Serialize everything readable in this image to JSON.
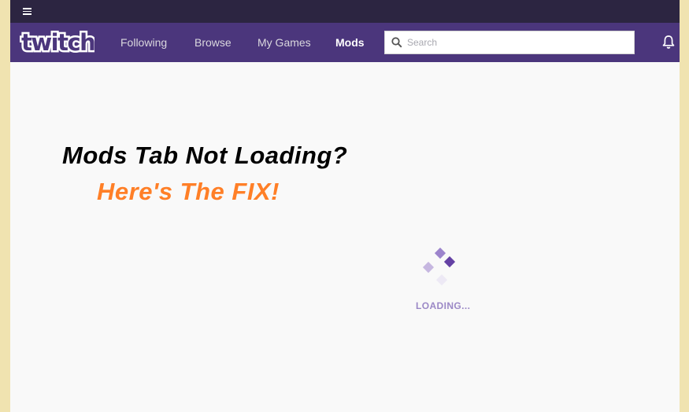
{
  "topbar": {
    "menu_icon": "hamburger-icon"
  },
  "navbar": {
    "logo_text": "twitch",
    "links": [
      {
        "label": "Following",
        "active": false
      },
      {
        "label": "Browse",
        "active": false
      },
      {
        "label": "My Games",
        "active": false
      },
      {
        "label": "Mods",
        "active": true
      }
    ],
    "search": {
      "placeholder": "Search",
      "value": "",
      "icon": "search-icon"
    },
    "notifications_icon": "bell-icon"
  },
  "overlay": {
    "headline": "Mods Tab Not Loading?",
    "subline": "Here's The FIX!"
  },
  "loader": {
    "text": "LOADING...",
    "colors": [
      "#9c84cc",
      "#6441a4",
      "#c6b7e0",
      "#ede9f5"
    ]
  },
  "colors": {
    "brand": "#4b367c",
    "topbar": "#2c2541",
    "accent_orange": "#ff7f27"
  }
}
